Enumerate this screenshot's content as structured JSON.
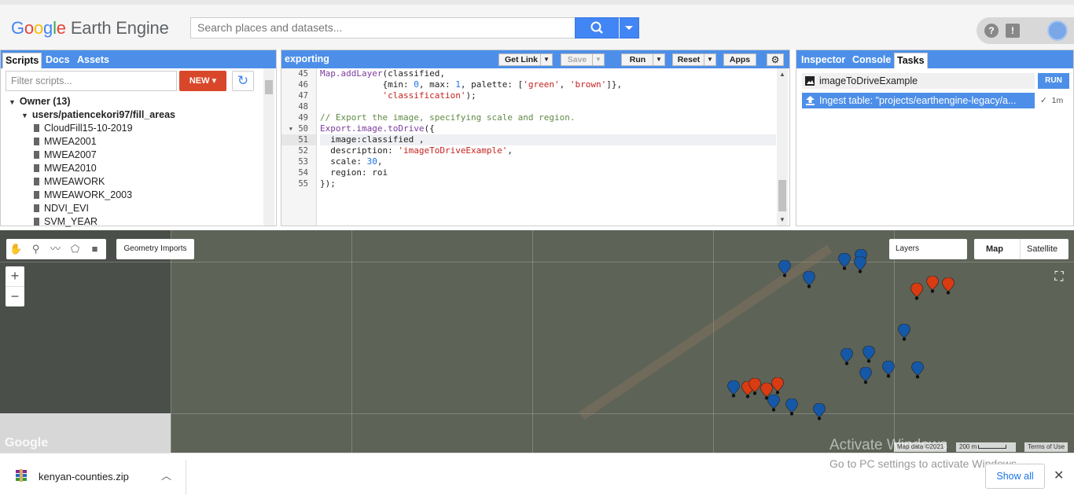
{
  "header": {
    "logo_g": [
      "G",
      "o",
      "o",
      "g",
      "l",
      "e"
    ],
    "logo_rest": "Earth Engine",
    "search_placeholder": "Search places and datasets...",
    "help_icon": "?",
    "feedback_icon": "!"
  },
  "left_panel": {
    "tabs": [
      "Scripts",
      "Docs",
      "Assets"
    ],
    "filter_placeholder": "Filter scripts...",
    "new_label": "NEW",
    "owner_label": "Owner (13)",
    "repo_label": "users/patiencekori97/fill_areas",
    "files": [
      "CloudFill15-10-2019",
      "MWEA2001",
      "MWEA2007",
      "MWEA2010",
      "MWEAWORK",
      "MWEAWORK_2003",
      "NDVI_EVI",
      "SVM_YEAR"
    ]
  },
  "editor": {
    "title": "exporting",
    "buttons": {
      "get_link": "Get Link",
      "save": "Save",
      "run": "Run",
      "reset": "Reset",
      "apps": "Apps"
    },
    "line_numbers": [
      "45",
      "46",
      "47",
      "48",
      "49",
      "50",
      "51",
      "52",
      "53",
      "54",
      "55"
    ]
  },
  "right_panel": {
    "tabs": [
      "Inspector",
      "Console",
      "Tasks"
    ],
    "task1_label": "imageToDriveExample",
    "run_label": "RUN",
    "task2_label": "Ingest table: \"projects/earthengine-legacy/a...",
    "task2_time": "1m"
  },
  "map": {
    "geometry_imports": "Geometry Imports",
    "layers": "Layers",
    "map_label": "Map",
    "satellite_label": "Satellite",
    "zoom_in": "+",
    "zoom_out": "−",
    "google_watermark": "Google",
    "activate_title": "Activate Windows",
    "map_data": "Map data ©2021",
    "scale": "200 m",
    "terms": "Terms of Use",
    "pin_colors": {
      "blue": "#1558a8",
      "red": "#d93b12"
    }
  },
  "download_bar": {
    "file_name": "kenyan-counties.zip",
    "activate_msg": "Go to PC settings to activate Windows.",
    "show_all": "Show all",
    "close": "✕"
  }
}
